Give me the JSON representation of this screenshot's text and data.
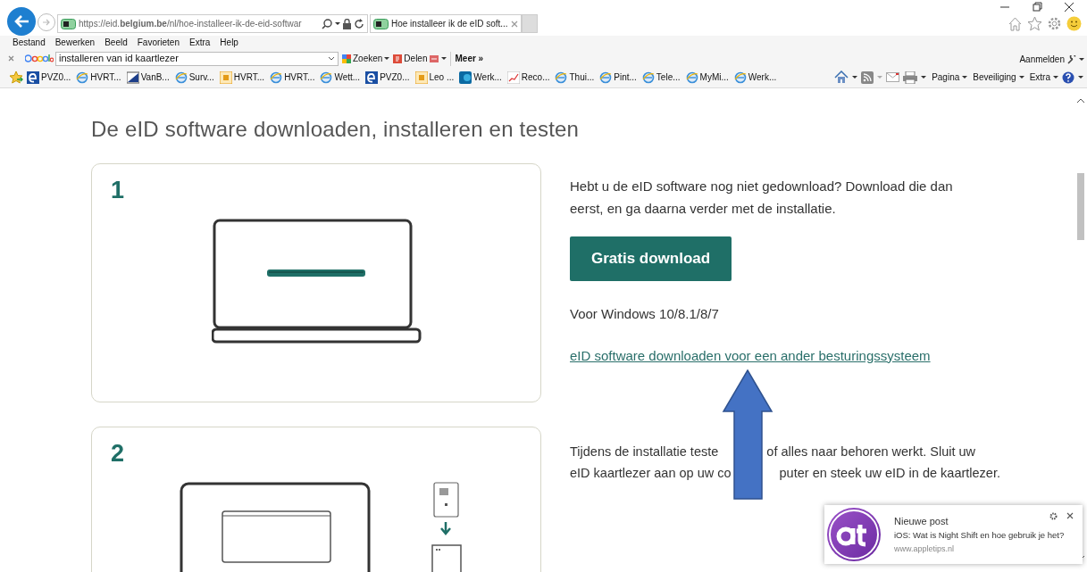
{
  "address_bar": {
    "url": "https://eid.**belgium.be**/nl/hoe-installeer-ik-de-eid-softwar"
  },
  "tabs": [
    {
      "label": "Hoe installeer ik de eID soft...",
      "selected": true
    }
  ],
  "menu_bar": [
    "Bestand",
    "Bewerken",
    "Beeld",
    "Favorieten",
    "Extra",
    "Help"
  ],
  "google_toolbar": {
    "search_value": "installeren van id kaartlezer",
    "buttons": [
      "Zoeken",
      "Delen",
      "Meer »"
    ],
    "sign_in": "Aanmelden"
  },
  "favorites": [
    {
      "label": "PVZ0...",
      "kind": "eblue"
    },
    {
      "label": "HVRT...",
      "kind": "ie"
    },
    {
      "label": "VanB...",
      "kind": "doc"
    },
    {
      "label": "Surv...",
      "kind": "ie"
    },
    {
      "label": "HVRT...",
      "kind": "outlook"
    },
    {
      "label": "HVRT...",
      "kind": "ie"
    },
    {
      "label": "Wett...",
      "kind": "ie"
    },
    {
      "label": "PVZ0...",
      "kind": "eblue"
    },
    {
      "label": "Leo ...",
      "kind": "outlook"
    },
    {
      "label": "Werk...",
      "kind": "sharepoint"
    },
    {
      "label": "Reco...",
      "kind": "chart"
    },
    {
      "label": "Thui...",
      "kind": "ie"
    },
    {
      "label": "Pint...",
      "kind": "ie"
    },
    {
      "label": "Tele...",
      "kind": "ie"
    },
    {
      "label": "MyMi...",
      "kind": "ie"
    },
    {
      "label": "Werk...",
      "kind": "ie"
    }
  ],
  "command_bar": [
    "Pagina",
    "Beveiliging",
    "Extra"
  ],
  "page": {
    "heading": "De eID software downloaden, installeren en testen",
    "steps": [
      {
        "number": "1",
        "kind": "download",
        "text": "Hebt u de eID software nog niet gedownload? Download die dan eerst, en ga daarna verder met de installatie.",
        "button": "Gratis download",
        "note": "Voor Windows 10/8.1/8/7",
        "link": "eID software downloaden voor een ander besturingssysteem"
      },
      {
        "number": "2",
        "kind": "reader",
        "text_lines": [
          [
            "Tijdens de installatie teste",
            "of alles naar behoren werkt. Sluit uw"
          ],
          [
            "eID kaartlezer aan op uw co",
            "puter en steek uw eID in de kaartlezer."
          ]
        ]
      }
    ]
  },
  "notification": {
    "title": "Nieuwe post",
    "message": "iOS: Wat is Night Shift en hoe gebruik je het?",
    "source": "www.appletips.nl"
  }
}
